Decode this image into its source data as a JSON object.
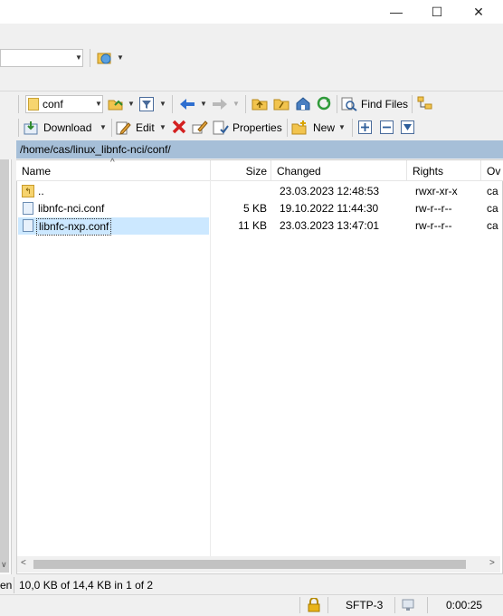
{
  "window": {
    "minimize_glyph": "—",
    "maximize_glyph": "☐",
    "close_glyph": "✕"
  },
  "toolbar": {
    "folder_combo_value": "conf",
    "download_label": "Download",
    "edit_label": "Edit",
    "properties_label": "Properties",
    "new_label": "New",
    "find_files_label": "Find Files"
  },
  "path": "/home/cas/linux_libnfc-nci/conf/",
  "columns": {
    "name": "Name",
    "size": "Size",
    "changed": "Changed",
    "rights": "Rights",
    "owner": "Ov"
  },
  "files": [
    {
      "name": "..",
      "size": "",
      "changed": "23.03.2023 12:48:53",
      "rights": "rwxr-xr-x",
      "owner": "ca"
    },
    {
      "name": "libnfc-nci.conf",
      "size": "5 KB",
      "changed": "19.10.2022 11:44:30",
      "rights": "rw-r--r--",
      "owner": "ca"
    },
    {
      "name": "libnfc-nxp.conf",
      "size": "11 KB",
      "changed": "23.03.2023 13:47:01",
      "rights": "rw-r--r--",
      "owner": "ca"
    }
  ],
  "status": {
    "left_fragment": "en",
    "selection_info": "10,0 KB of 14,4 KB in 1 of 2",
    "protocol": "SFTP-3",
    "elapsed": "0:00:25"
  },
  "colors": {
    "path_bar": "#a6bfd8",
    "selected_row": "#cce8ff",
    "delete_red": "#d32020"
  }
}
